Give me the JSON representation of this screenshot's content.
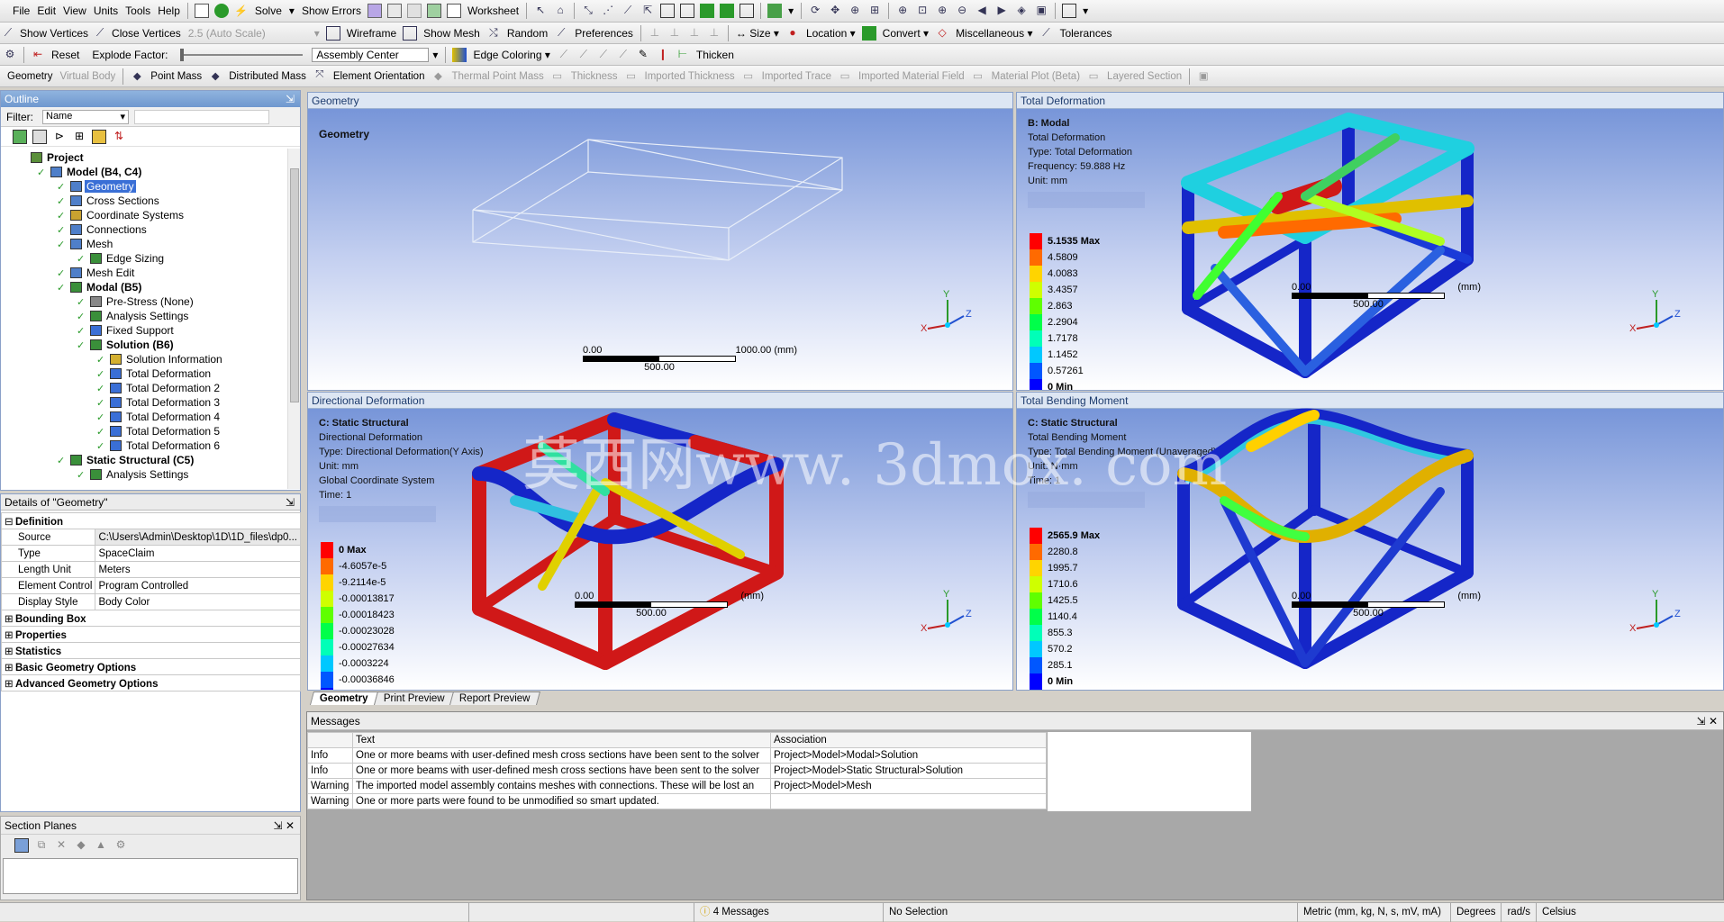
{
  "menu": [
    "File",
    "Edit",
    "View",
    "Units",
    "Tools",
    "Help"
  ],
  "toolbar1": {
    "solve": "Solve",
    "show_errors": "Show Errors",
    "worksheet": "Worksheet"
  },
  "toolbar2": {
    "show_vertices": "Show Vertices",
    "close_vertices": "Close Vertices",
    "auto_scale": "2.5 (Auto Scale)",
    "wireframe": "Wireframe",
    "show_mesh": "Show Mesh",
    "random": "Random",
    "preferences": "Preferences",
    "size": "Size",
    "location": "Location",
    "convert": "Convert",
    "misc": "Miscellaneous",
    "tolerances": "Tolerances"
  },
  "toolbar3": {
    "reset": "Reset",
    "explode_factor": "Explode Factor:",
    "assembly_center": "Assembly Center",
    "edge_coloring": "Edge Coloring",
    "thicken": "Thicken"
  },
  "toolbar4": {
    "geometry": "Geometry",
    "virtual_body": "Virtual Body",
    "point_mass": "Point Mass",
    "distributed_mass": "Distributed Mass",
    "element_orientation": "Element Orientation",
    "thermal_point_mass": "Thermal Point Mass",
    "thickness": "Thickness",
    "imported_thickness": "Imported Thickness",
    "imported_trace": "Imported Trace",
    "imported_material_field": "Imported Material Field",
    "material_plot": "Material Plot (Beta)",
    "layered_section": "Layered Section"
  },
  "outline": {
    "title": "Outline",
    "filter_label": "Filter:",
    "filter_value": "Name",
    "items": [
      {
        "label": "Project",
        "indent": 0,
        "bold": true,
        "icon": "project-icon",
        "color": "#5a8f3a"
      },
      {
        "label": "Model (B4, C4)",
        "indent": 1,
        "bold": true,
        "icon": "model-icon",
        "color": "#4f7fc9"
      },
      {
        "label": "Geometry",
        "indent": 2,
        "selected": true,
        "icon": "geometry-icon",
        "color": "#4f7fc9"
      },
      {
        "label": "Cross Sections",
        "indent": 2,
        "icon": "cross-sections-icon",
        "color": "#4f7fc9"
      },
      {
        "label": "Coordinate Systems",
        "indent": 2,
        "icon": "coordinate-systems-icon",
        "color": "#c9a230"
      },
      {
        "label": "Connections",
        "indent": 2,
        "icon": "connections-icon",
        "color": "#4f7fc9"
      },
      {
        "label": "Mesh",
        "indent": 2,
        "icon": "mesh-icon",
        "color": "#4f7fc9"
      },
      {
        "label": "Edge Sizing",
        "indent": 3,
        "icon": "edge-sizing-icon",
        "color": "#3a8f3a"
      },
      {
        "label": "Mesh Edit",
        "indent": 2,
        "icon": "mesh-edit-icon",
        "color": "#4f7fc9"
      },
      {
        "label": "Modal (B5)",
        "indent": 2,
        "bold": true,
        "icon": "modal-icon",
        "color": "#3a8f3a"
      },
      {
        "label": "Pre-Stress (None)",
        "indent": 3,
        "icon": "prestress-icon",
        "color": "#888888"
      },
      {
        "label": "Analysis Settings",
        "indent": 3,
        "icon": "analysis-settings-icon",
        "color": "#3a8f3a"
      },
      {
        "label": "Fixed Support",
        "indent": 3,
        "icon": "fixed-support-icon",
        "color": "#3a6fd6"
      },
      {
        "label": "Solution (B6)",
        "indent": 3,
        "bold": true,
        "icon": "solution-icon",
        "color": "#3a8f3a"
      },
      {
        "label": "Solution Information",
        "indent": 4,
        "icon": "solution-information-icon",
        "color": "#d4b030"
      },
      {
        "label": "Total Deformation",
        "indent": 4,
        "icon": "result-icon",
        "color": "#3a6fd6"
      },
      {
        "label": "Total Deformation 2",
        "indent": 4,
        "icon": "result-icon",
        "color": "#3a6fd6"
      },
      {
        "label": "Total Deformation 3",
        "indent": 4,
        "icon": "result-icon",
        "color": "#3a6fd6"
      },
      {
        "label": "Total Deformation 4",
        "indent": 4,
        "icon": "result-icon",
        "color": "#3a6fd6"
      },
      {
        "label": "Total Deformation 5",
        "indent": 4,
        "icon": "result-icon",
        "color": "#3a6fd6"
      },
      {
        "label": "Total Deformation 6",
        "indent": 4,
        "icon": "result-icon",
        "color": "#3a6fd6"
      },
      {
        "label": "Static Structural (C5)",
        "indent": 2,
        "bold": true,
        "icon": "static-structural-icon",
        "color": "#3a8f3a"
      },
      {
        "label": "Analysis Settings",
        "indent": 3,
        "icon": "analysis-settings-icon",
        "color": "#3a8f3a"
      }
    ]
  },
  "details": {
    "title": "Details of \"Geometry\"",
    "rows": [
      {
        "group": true,
        "label": "Definition",
        "expanded": true
      },
      {
        "label": "Source",
        "value": "C:\\Users\\Admin\\Desktop\\1D\\1D_files\\dp0..."
      },
      {
        "label": "Type",
        "value": "SpaceClaim"
      },
      {
        "label": "Length Unit",
        "value": "Meters"
      },
      {
        "label": "Element Control",
        "value": "Program Controlled"
      },
      {
        "label": "Display Style",
        "value": "Body Color"
      },
      {
        "group": true,
        "label": "Bounding Box"
      },
      {
        "group": true,
        "label": "Properties"
      },
      {
        "group": true,
        "label": "Statistics"
      },
      {
        "group": true,
        "label": "Basic Geometry Options"
      },
      {
        "group": true,
        "label": "Advanced Geometry Options"
      }
    ]
  },
  "section_planes": {
    "title": "Section Planes"
  },
  "viewports": {
    "geometry": {
      "header": "Geometry",
      "title": "Geometry",
      "scale_left": "0.00",
      "scale_right": "1000.00 (mm)",
      "scale_mid": "500.00"
    },
    "total_deformation": {
      "header": "Total Deformation",
      "lines": [
        "B: Modal",
        "Total Deformation",
        "Type: Total Deformation",
        "Frequency: 59.888 Hz",
        "Unit: mm"
      ],
      "legend": [
        "5.1535 Max",
        "4.5809",
        "4.0083",
        "3.4357",
        "2.863",
        "2.2904",
        "1.7178",
        "1.1452",
        "0.57261",
        "0 Min"
      ],
      "scale_left": "0.00",
      "scale_right": "(mm)",
      "scale_mid": "500.00"
    },
    "directional_deformation": {
      "header": "Directional Deformation",
      "lines": [
        "C: Static Structural",
        "Directional Deformation",
        "Type: Directional Deformation(Y Axis)",
        "Unit: mm",
        "Global Coordinate System",
        "Time: 1"
      ],
      "legend": [
        "0 Max",
        "-4.6057e-5",
        "-9.2114e-5",
        "-0.00013817",
        "-0.00018423",
        "-0.00023028",
        "-0.00027634",
        "-0.0003224",
        "-0.00036846",
        ""
      ],
      "scale_left": "0.00",
      "scale_right": "(mm)",
      "scale_mid": "500.00"
    },
    "total_bending_moment": {
      "header": "Total Bending Moment",
      "lines": [
        "C: Static Structural",
        "Total Bending Moment",
        "Type: Total Bending Moment (Unaveraged)",
        "Unit: N·mm",
        "Time: 1"
      ],
      "legend": [
        "2565.9 Max",
        "2280.8",
        "1995.7",
        "1710.6",
        "1425.5",
        "1140.4",
        "855.3",
        "570.2",
        "285.1",
        "0 Min"
      ],
      "scale_left": "0.00",
      "scale_right": "(mm)",
      "scale_mid": "500.00"
    }
  },
  "legend_colors": [
    "#ff0000",
    "#ff6a00",
    "#ffd400",
    "#cfff00",
    "#5fff00",
    "#00ff4a",
    "#00ffb8",
    "#00c8ff",
    "#0057ff",
    "#0000ff"
  ],
  "axis": {
    "x": "X",
    "y": "Y",
    "z": "Z"
  },
  "view_tabs": [
    "Geometry",
    "Print Preview",
    "Report Preview"
  ],
  "messages": {
    "title": "Messages",
    "columns": [
      "",
      "Text",
      "Association"
    ],
    "rows": [
      [
        "Info",
        "One or more beams with user-defined mesh cross sections have been sent to the solver",
        "Project>Model>Modal>Solution"
      ],
      [
        "Info",
        "One or more beams with user-defined mesh cross sections have been sent to the solver",
        "Project>Model>Static Structural>Solution"
      ],
      [
        "Warning",
        "The imported model assembly contains meshes with connections. These will be lost an",
        "Project>Model>Mesh"
      ],
      [
        "Warning",
        "One or more parts were found to be unmodified so smart updated.",
        ""
      ]
    ]
  },
  "status": {
    "messages": "4 Messages",
    "selection": "No Selection",
    "units": "Metric (mm, kg, N, s, mV, mA)",
    "degrees": "Degrees",
    "rads": "rad/s",
    "temp": "Celsius"
  },
  "watermark": "莫西网www. 3dmox. com"
}
